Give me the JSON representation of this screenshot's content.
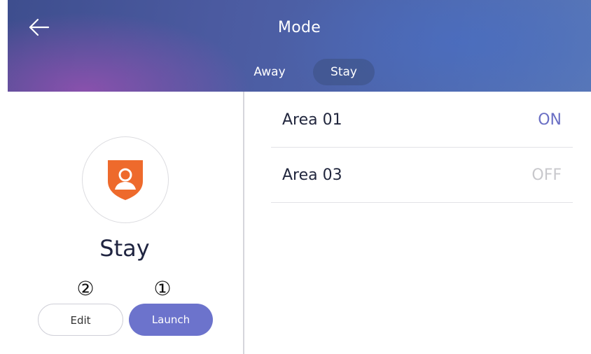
{
  "header": {
    "title": "Mode",
    "back_icon": "arrow-left-icon",
    "tabs": [
      {
        "label": "Away",
        "selected": false
      },
      {
        "label": "Stay",
        "selected": true
      }
    ]
  },
  "mode_panel": {
    "icon": "shield-user-icon",
    "icon_color": "#ee6a2c",
    "name": "Stay",
    "edit_label": "Edit",
    "launch_label": "Launch",
    "marker_edit": "②",
    "marker_launch": "①"
  },
  "areas": [
    {
      "name": "Area 01",
      "status": "ON"
    },
    {
      "name": "Area 03",
      "status": "OFF"
    }
  ],
  "colors": {
    "accent": "#6c73cc",
    "on": "#6a6fc4",
    "off": "#c8c8cc"
  }
}
